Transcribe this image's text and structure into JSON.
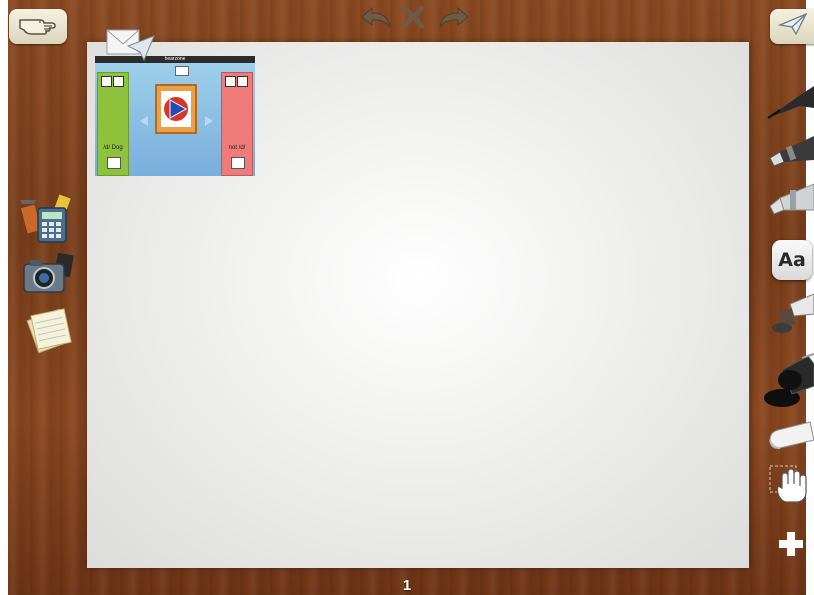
{
  "toolbar": {
    "menu_icon": "pointing-hand-icon",
    "share_icon": "paper-plane-icon",
    "undo_icon": "undo-icon",
    "clear_icon": "close-icon",
    "redo_icon": "redo-icon"
  },
  "left_tools": [
    {
      "name": "apps-tool",
      "icon": "calculator-tools-icon"
    },
    {
      "name": "camera-tool",
      "icon": "camera-icon"
    },
    {
      "name": "notes-tool",
      "icon": "notepad-icon"
    }
  ],
  "right_tools": [
    {
      "name": "pen-tool",
      "icon": "pen-icon"
    },
    {
      "name": "marker-tool",
      "icon": "marker-icon"
    },
    {
      "name": "brush-tool",
      "icon": "brush-icon"
    },
    {
      "name": "text-tool",
      "icon": "text-icon",
      "label": "Aa"
    },
    {
      "name": "stamp-tool",
      "icon": "stamp-icon"
    },
    {
      "name": "fill-tool",
      "icon": "paint-bucket-icon"
    },
    {
      "name": "eraser-tool",
      "icon": "eraser-icon"
    },
    {
      "name": "pan-tool",
      "icon": "hand-icon"
    },
    {
      "name": "add-tool",
      "icon": "plus-icon"
    }
  ],
  "thumbnail": {
    "title": "hearzone",
    "left_label": "/d/ Dog",
    "right_label": "not /d/"
  },
  "page": {
    "number": "1"
  },
  "colors": {
    "wood": "#7a3e1b",
    "canvas": "#f1f1f0",
    "button": "#f6f1df",
    "left_panel": "#8fc23c",
    "right_panel": "#ef7a7a"
  }
}
